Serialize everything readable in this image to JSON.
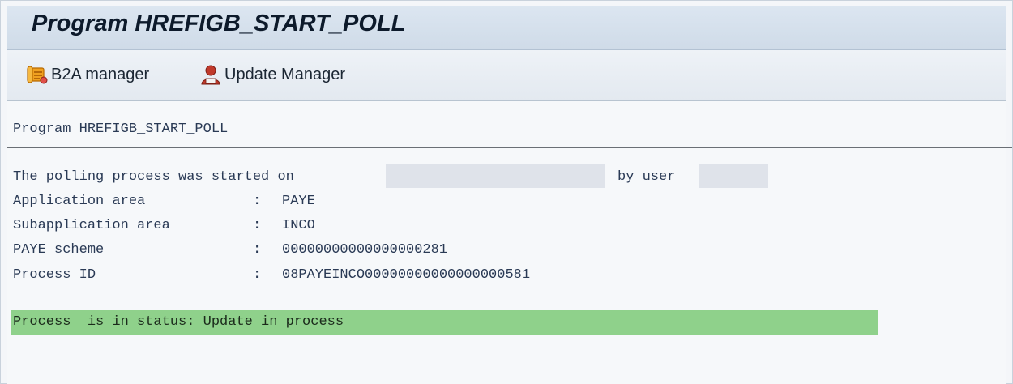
{
  "window": {
    "title": "Program HREFIGB_START_POLL"
  },
  "toolbar": {
    "b2a_label": "B2A manager",
    "b2a_icon": "b2a-scroll-icon",
    "update_label": "Update Manager",
    "update_icon": "user-icon"
  },
  "report": {
    "header": "Program HREFIGB_START_POLL",
    "started_prefix": "The polling process was started on",
    "by_user": "by user",
    "fields": [
      {
        "label": "Application area",
        "colon": ":",
        "value": "PAYE"
      },
      {
        "label": "Subapplication area",
        "colon": ":",
        "value": "INCO"
      },
      {
        "label": "PAYE scheme",
        "colon": ":",
        "value": "00000000000000000281"
      },
      {
        "label": "Process ID",
        "colon": ":",
        "value": "08PAYEINCO00000000000000000581"
      }
    ],
    "status_message": "Process  is in status: Update in process"
  },
  "colors": {
    "status_background": "#8fd18b",
    "text": "#2a3a55",
    "title_bar": "#dce6f1"
  }
}
